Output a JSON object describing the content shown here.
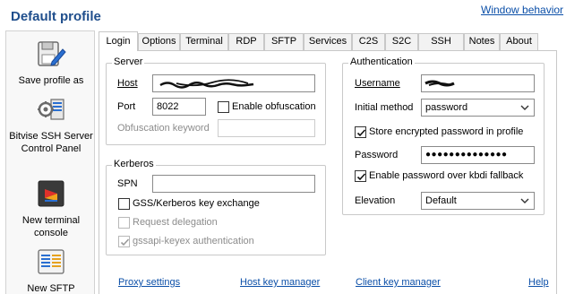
{
  "header": {
    "title": "Default profile",
    "window_behavior": "Window behavior"
  },
  "sidebar": {
    "items": [
      {
        "label": "Save profile as",
        "icon": "save-profile-icon"
      },
      {
        "label": "Bitvise SSH Server Control Panel",
        "icon": "server-control-panel-icon"
      },
      {
        "label": "New terminal console",
        "icon": "terminal-console-icon"
      },
      {
        "label": "New SFTP",
        "icon": "sftp-window-icon"
      }
    ]
  },
  "tabs": [
    {
      "label": "Login"
    },
    {
      "label": "Options"
    },
    {
      "label": "Terminal"
    },
    {
      "label": "RDP"
    },
    {
      "label": "SFTP"
    },
    {
      "label": "Services"
    },
    {
      "label": "C2S"
    },
    {
      "label": "S2C"
    },
    {
      "label": "SSH"
    },
    {
      "label": "Notes"
    },
    {
      "label": "About"
    }
  ],
  "server": {
    "group_label": "Server",
    "host_label": "Host",
    "port_label": "Port",
    "port_value": "8022",
    "enable_obfuscation_label": "Enable obfuscation",
    "obfuscation_keyword_label": "Obfuscation keyword"
  },
  "kerberos": {
    "group_label": "Kerberos",
    "spn_label": "SPN",
    "gss_label": "GSS/Kerberos key exchange",
    "request_delegation_label": "Request delegation",
    "gssapi_label": "gssapi-keyex authentication"
  },
  "authentication": {
    "group_label": "Authentication",
    "username_label": "Username",
    "initial_method_label": "Initial method",
    "initial_method_value": "password",
    "store_password_label": "Store encrypted password in profile",
    "password_label": "Password",
    "password_value": "●●●●●●●●●●●●●●",
    "kbdi_label": "Enable password over kbdi fallback",
    "elevation_label": "Elevation",
    "elevation_value": "Default"
  },
  "footer": {
    "proxy_settings": "Proxy settings",
    "host_key_manager": "Host key manager",
    "client_key_manager": "Client key manager",
    "help": "Help"
  },
  "colors": {
    "title": "#1f4e8c",
    "link": "#0b4fa8"
  }
}
